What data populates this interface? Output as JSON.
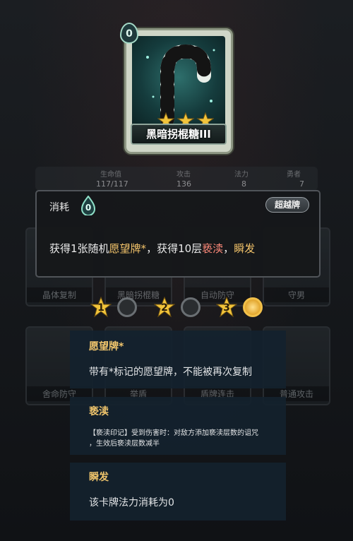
{
  "card": {
    "cost": "0",
    "name": "黑暗拐棍糖III"
  },
  "stats": {
    "hp_label": "生命值",
    "hp": "117/117",
    "atk_label": "攻击",
    "atk": "136",
    "mp_label": "法力",
    "mp": "8",
    "ext_label": "勇者",
    "ext": "7"
  },
  "background_cards": [
    {
      "name": "晶体复制"
    },
    {
      "name": "黑暗拐棍糖"
    },
    {
      "name": "自动防守"
    },
    {
      "name": "守男"
    },
    {
      "name": "舍命防守"
    },
    {
      "name": "举盾"
    },
    {
      "name": "盾牌连击"
    },
    {
      "name": "普通攻击"
    }
  ],
  "tooltip": {
    "type": "消耗",
    "cost": "0",
    "badge": "超越牌",
    "desc_part1": "获得1张随机",
    "desc_hl1": "愿望牌*",
    "desc_part2": "，获得10层",
    "desc_hl2": "亵渎",
    "desc_part3": "，",
    "desc_hl3": "瞬发"
  },
  "levels": [
    {
      "num": "1"
    },
    {
      "num": "2"
    },
    {
      "num": "3"
    }
  ],
  "keywords": [
    {
      "title": "愿望牌*",
      "text": "带有*标记的愿望牌，不能被再次复制"
    },
    {
      "title": "亵渎",
      "text_line1": "【亵渎印记】受到伤害时：对敌方添加亵渎层数的诅咒",
      "text_line2": "，生效后亵渎层数减半"
    },
    {
      "title": "瞬发",
      "text": "该卡牌法力消耗为0"
    }
  ],
  "colors": {
    "gold_highlight": "#f3c36a",
    "red_highlight": "#ff8a7a",
    "card_glow": "#2e6f6c"
  }
}
